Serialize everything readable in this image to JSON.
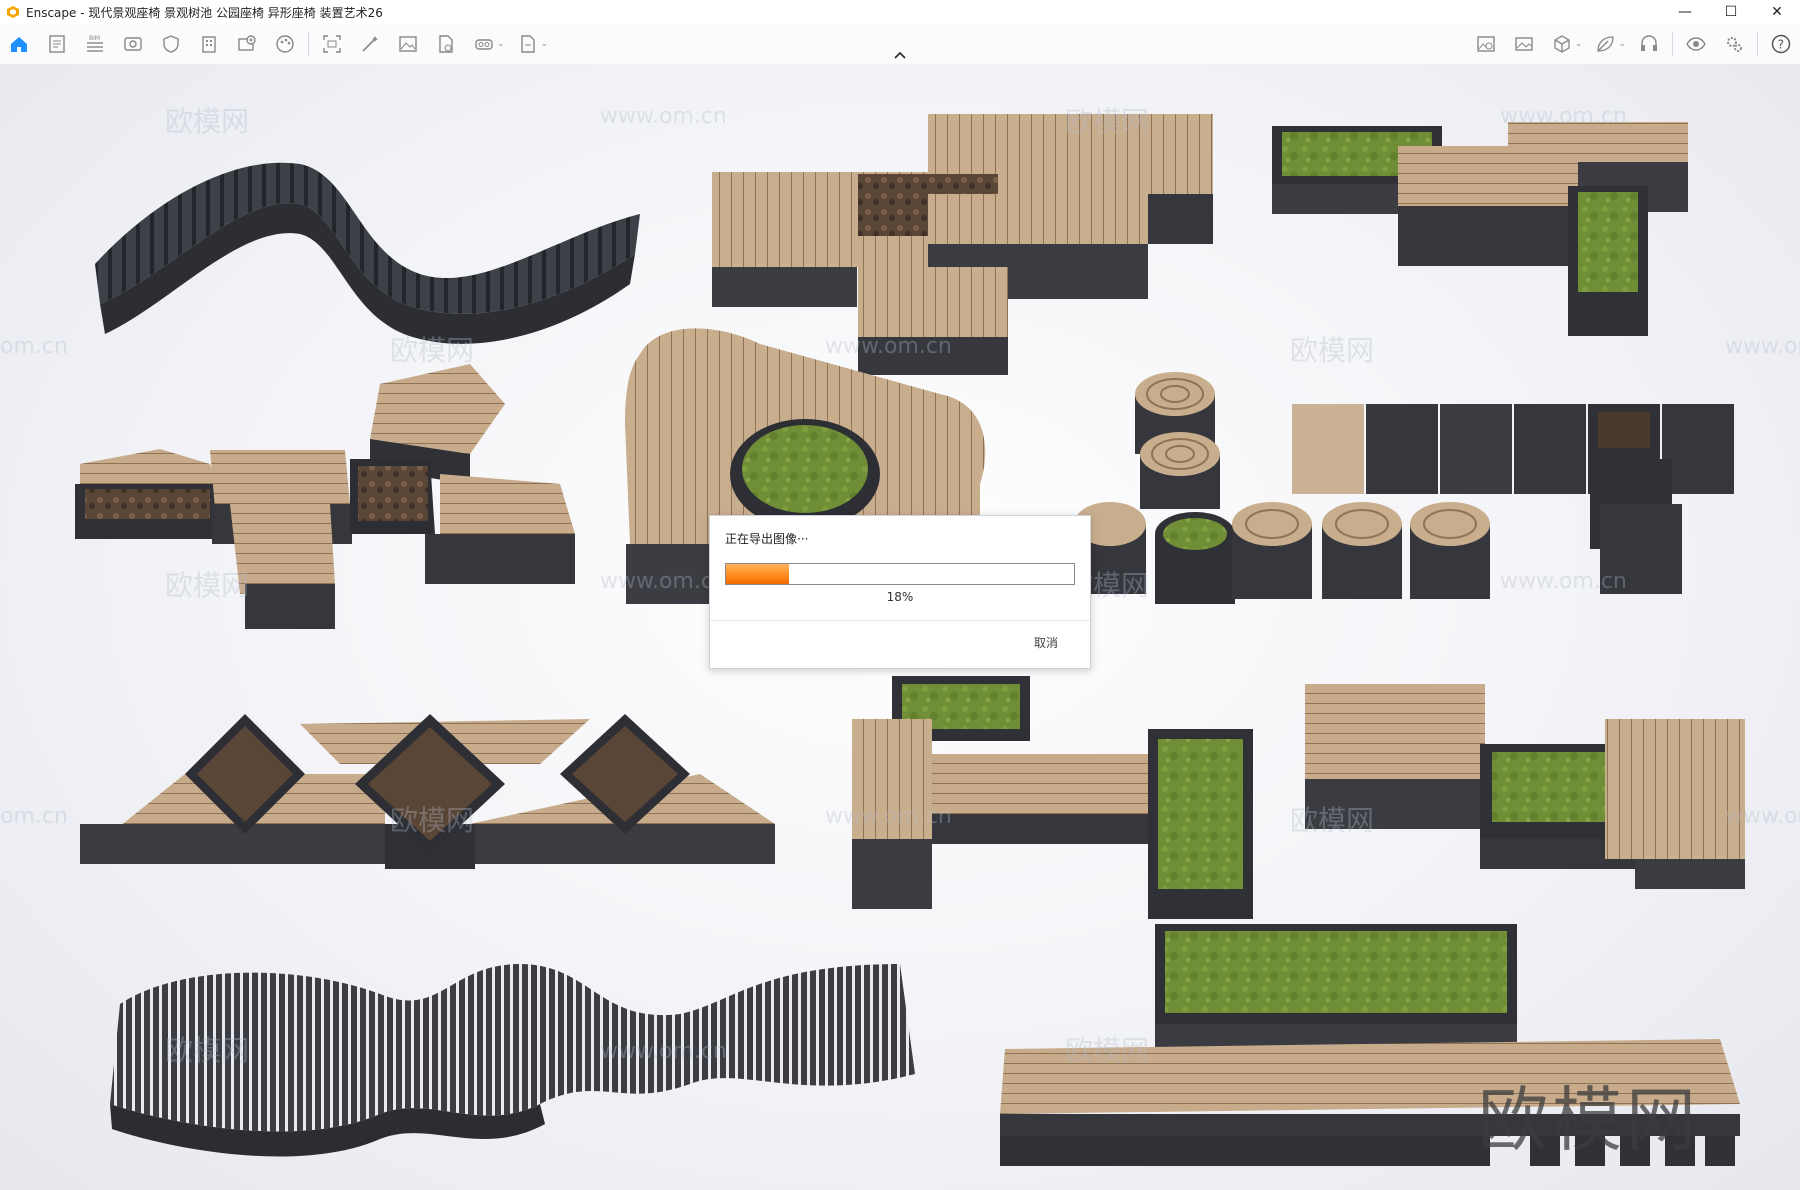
{
  "window": {
    "title": "Enscape - 现代景观座椅 景观树池 公园座椅 异形座椅 装置艺术26",
    "minimize_icon": "minimize-icon",
    "maximize_icon": "maximize-icon",
    "close_icon": "close-icon"
  },
  "toolbar": {
    "left_icons": [
      "home-icon",
      "document-icon",
      "bim-icon",
      "view-icon",
      "shield-icon",
      "building-icon",
      "add-view-icon",
      "palette-icon"
    ],
    "mid_icons": [
      "capture-icon",
      "wand-icon",
      "image-icon",
      "export-file-icon",
      "vr-headset-icon",
      "export-icon"
    ],
    "right_icons": [
      "image-settings-icon",
      "gallery-icon",
      "cube-icon",
      "leaf-icon",
      "headset-icon",
      "eye-icon",
      "gears-icon",
      "help-icon"
    ]
  },
  "watermarks": {
    "brand_cn": "欧模网",
    "brand_url": "www.om.cn",
    "brand_url_short": "om.cn"
  },
  "export_dialog": {
    "title": "正在导出图像···",
    "progress": 0.18,
    "progress_text": "18%",
    "cancel_label": "取消",
    "progress_color": "#ff8a1a"
  },
  "colors": {
    "wood": "#c9ae8e",
    "dark_base": "#3d3f44",
    "grass": "#6e8f34",
    "accent": "#1e90ff"
  }
}
